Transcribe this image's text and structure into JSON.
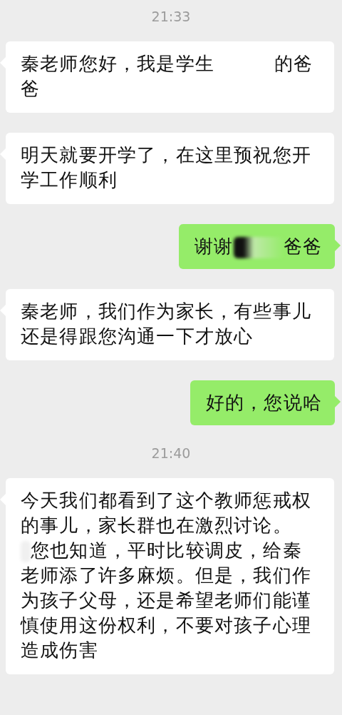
{
  "items": [
    {
      "kind": "time",
      "text": "21:33"
    },
    {
      "kind": "received",
      "lines": [
        [
          {
            "kind": "text",
            "text": "秦老师您好，我是学生"
          },
          {
            "kind": "blot"
          },
          {
            "kind": "text",
            "text": "的爸"
          }
        ],
        [
          {
            "kind": "text",
            "text": "爸"
          }
        ]
      ]
    },
    {
      "kind": "received",
      "lines": [
        [
          {
            "kind": "text",
            "text": "明天就要开学了，在这里预祝您开"
          }
        ],
        [
          {
            "kind": "text",
            "text": "学工作顺利"
          }
        ]
      ]
    },
    {
      "kind": "sent",
      "lines": [
        [
          {
            "kind": "text",
            "text": "谢谢"
          },
          {
            "kind": "smudge"
          },
          {
            "kind": "text",
            "text": "爸爸"
          }
        ]
      ]
    },
    {
      "kind": "received",
      "lines": [
        [
          {
            "kind": "text",
            "text": "秦老师，我们作为家长，有些事儿"
          }
        ],
        [
          {
            "kind": "text",
            "text": "还是得跟您沟通一下才放心"
          }
        ]
      ]
    },
    {
      "kind": "sent",
      "lines": [
        [
          {
            "kind": "text",
            "text": "好的，您说哈"
          }
        ]
      ]
    },
    {
      "kind": "time",
      "text": "21:40"
    },
    {
      "kind": "received",
      "lines": [
        [
          {
            "kind": "text",
            "text": "今天我们都看到了这个教师惩戒权"
          }
        ],
        [
          {
            "kind": "text",
            "text": "的事儿，家长群也在激烈讨论。"
          }
        ],
        [
          {
            "kind": "speck"
          },
          {
            "kind": "text",
            "text": "您也知道，平时比较调皮，给秦"
          }
        ],
        [
          {
            "kind": "text",
            "text": "老师添了许多麻烦。但是，我们作"
          }
        ],
        [
          {
            "kind": "text",
            "text": "为孩子父母，还是希望老师们能谨"
          }
        ],
        [
          {
            "kind": "text",
            "text": "慎使用这份权利，不要对孩子心理"
          }
        ],
        [
          {
            "kind": "text",
            "text": "造成伤害"
          }
        ]
      ]
    }
  ]
}
